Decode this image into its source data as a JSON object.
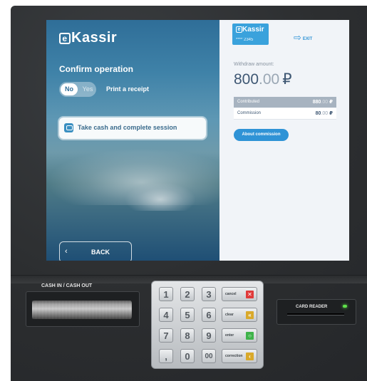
{
  "brand": {
    "letter": "e",
    "name": "Kassir"
  },
  "left": {
    "title": "Confirm operation",
    "toggle": {
      "no": "No",
      "yes": "Yes"
    },
    "receipt_label": "Print a receipt",
    "take_cash_label": "Take cash and complete session",
    "back_label": "BACK",
    "back_chevron": "‹"
  },
  "right": {
    "card": {
      "brand_letter": "e",
      "brand_name": "Kassir",
      "number": "**** 2345"
    },
    "exit_icon": "⇨",
    "exit_label": "EXIT",
    "withdraw_label": "Withdraw amount:",
    "amount_main": "800",
    "amount_cents": ".00",
    "currency": "₽",
    "rows": [
      {
        "label": "Contributed",
        "main": "880",
        "cents": ".00",
        "currency": "₽"
      },
      {
        "label": "Commission",
        "main": "80",
        "cents": ".00",
        "currency": "₽"
      }
    ],
    "about_label": "About commission"
  },
  "hardware": {
    "cash_slot_label": "CASH IN / CASH OUT",
    "card_reader_label": "CARD READER",
    "keys": [
      "1",
      "2",
      "3",
      "4",
      "5",
      "6",
      "7",
      "8",
      "9",
      ",",
      "0",
      "00"
    ],
    "fkeys": [
      {
        "label": "cancel",
        "symbol": "✕",
        "color": "#e03a3a"
      },
      {
        "label": "clear",
        "symbol": "«",
        "color": "#d9a92b"
      },
      {
        "label": "enter",
        "symbol": "○",
        "color": "#3fb34a"
      },
      {
        "label": "correction",
        "symbol": "‹",
        "color": "#d9a92b"
      }
    ]
  },
  "colors": {
    "accent": "#2f93d6",
    "text_dark": "#3e5773",
    "panel_bg": "#f1f4f8"
  }
}
